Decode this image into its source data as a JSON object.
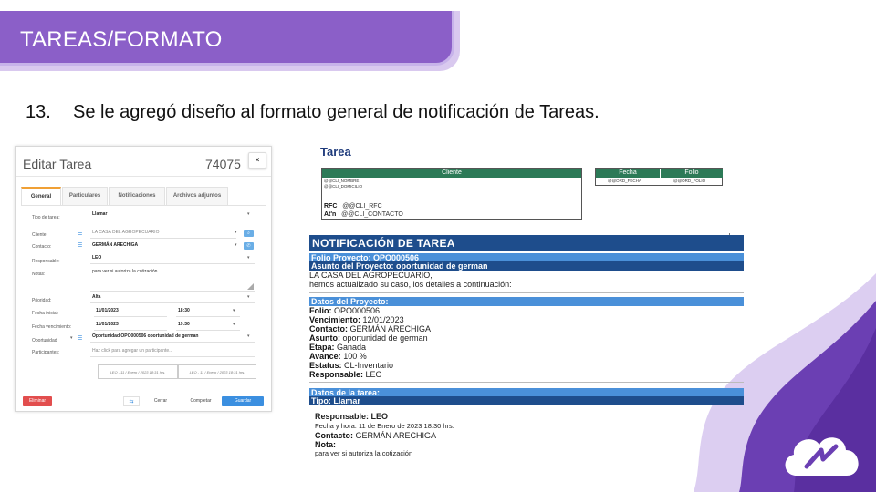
{
  "slide": {
    "title": "TAREAS/FORMATO",
    "bullet_number": "13.",
    "bullet_text": "Se le agregó diseño al formato general de notificación de Tareas."
  },
  "modal": {
    "title": "Editar Tarea",
    "number": "74075",
    "close": "×",
    "tabs": [
      "General",
      "Particulares",
      "Notificaciones",
      "Archivos adjuntos"
    ],
    "fields": {
      "tipo_label": "Tipo de tarea:",
      "tipo_value": "Llamar",
      "cliente_label": "Cliente:",
      "cliente_value": "LA CASA DEL AGROPECUARIO",
      "contacto_label": "Contacto:",
      "contacto_value": "GERMÁN ARECHIGA",
      "responsable_label": "Responsable:",
      "responsable_value": "LEO",
      "notas_label": "Notas:",
      "notas_value": "para ver si autoriza la cotización",
      "prioridad_label": "Prioridad:",
      "prioridad_value": "Alta",
      "fecha_inicial_label": "Fecha inicial:",
      "fecha_inicial_value": "11/01/2023",
      "hora_inicial_value": "18:30",
      "fecha_venc_label": "Fecha vencimiento:",
      "fecha_venc_value": "11/01/2023",
      "hora_venc_value": "19:30",
      "oportunidad_label": "Oportunidad",
      "oportunidad_value": "Oportunidad OPO000506 oportunidad de german",
      "participantes_label": "Participantes:",
      "participantes_placeholder": "Haz click para agregar un participante...",
      "stamp_1": "LEO - 11 / Enero / 2023 18:31 hrs.",
      "stamp_2": "LEO - 11 / Enero / 2023 18:31 hrs."
    },
    "buttons": {
      "delete": "Eliminar",
      "export": "⇆",
      "close": "Cerrar",
      "complete": "Completar",
      "save": "Guardar"
    }
  },
  "template": {
    "heading": "Tarea",
    "cliente_header": "Cliente",
    "cli_nombre": "@@CLI_NOMBRE",
    "cli_domicilio": "@@CLI_DOMICILIO",
    "rfc_label": "RFC",
    "rfc_value": "@@CLI_RFC",
    "atn_label": "At'n",
    "atn_value": "@@CLI_CONTACTO",
    "fecha_header": "Fecha",
    "folio_header": "Folio",
    "fecha_value": "@@ORD_FECHA",
    "folio_value": "@@ORD_FOLIO"
  },
  "notification": {
    "title": "NOTIFICACIÓN DE TAREA",
    "folio_bar": "Folio Proyecto: OPO000506",
    "asunto_bar": "Asunto del Proyecto: oportunidad de german",
    "intro_1": "LA CASA DEL AGROPECUARIO,",
    "intro_2": "hemos actualizado su caso, los detalles a continuación:",
    "datos_bar": "Datos del Proyecto:",
    "details": [
      {
        "label": "Folio:",
        "value": "OPO000506"
      },
      {
        "label": "Vencimiento:",
        "value": "12/01/2023"
      },
      {
        "label": "Contacto:",
        "value": "GERMÁN ARECHIGA"
      },
      {
        "label": "Asunto:",
        "value": "oportunidad de german"
      },
      {
        "label": "Etapa:",
        "value": "Ganada"
      },
      {
        "label": "Avance:",
        "value": "100 %"
      },
      {
        "label": "Estatus:",
        "value": "CL-Inventario"
      },
      {
        "label": "Responsable:",
        "value": "LEO"
      }
    ],
    "datos_tarea_bar": "Datos de la tarea:",
    "tipo_bar": "Tipo: Llamar",
    "task_responsable": "Responsable: LEO",
    "task_fecha": "Fecha y hora: 11 de Enero de 2023 18:30 hrs.",
    "task_contacto_label": "Contacto:",
    "task_contacto_value": "GERMÁN ARECHIGA",
    "task_nota_label": "Nota:",
    "task_nota_value": "para ver si autoriza la cotización"
  },
  "colors": {
    "banner": "#8b5fc8",
    "notif_dark": "#1e4d8c",
    "notif_light": "#4a90d9",
    "table_header": "#2c7a57",
    "accent_blue": "#3b8fe0",
    "delete_red": "#e24e4e"
  }
}
